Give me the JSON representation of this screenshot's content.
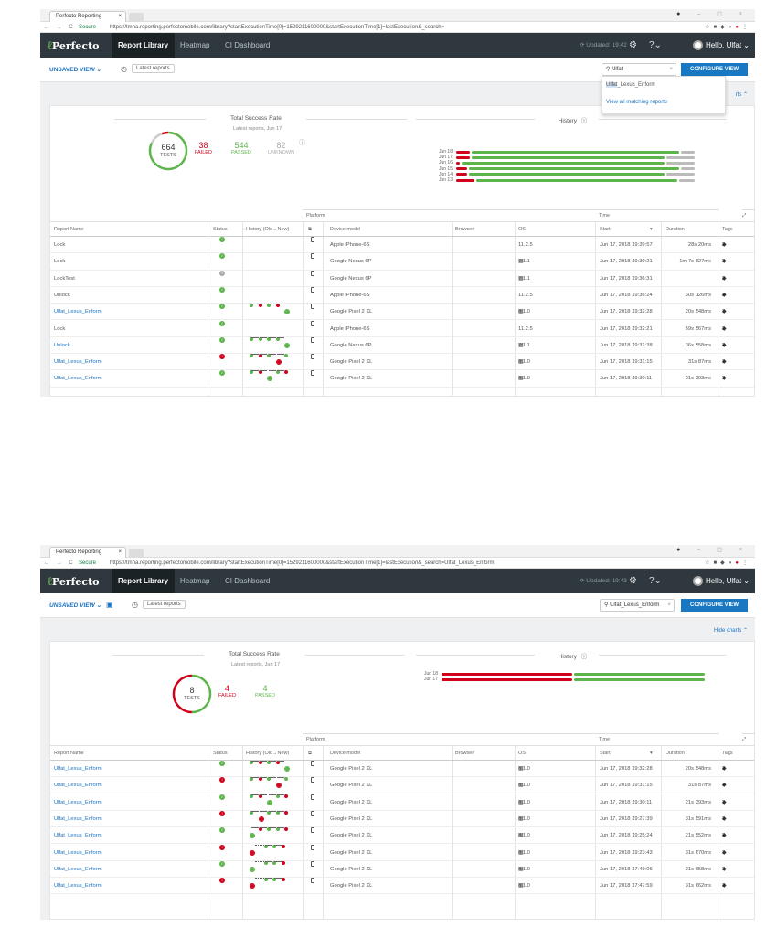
{
  "browser": {
    "tab_title": "Perfecto Reporting",
    "tab_close": "×",
    "nav": "← → C",
    "secure": "Secure",
    "window_controls": "– ◻ ×"
  },
  "app": {
    "logo": "Perfecto",
    "nav": [
      {
        "label": "Report Library"
      },
      {
        "label": "Heatmap"
      },
      {
        "label": "CI Dashboard"
      }
    ],
    "hello": "Hello, Ulfat"
  },
  "toolbar": {
    "unsaved_view": "UNSAVED VIEW",
    "latest": "Latest reports",
    "configure": "CONFIGURE VIEW"
  },
  "colors": {
    "accent": "#1a78c2",
    "header": "#2e383e",
    "passed": "#5db44b",
    "failed": "#d0021b",
    "unknown": "#aaaaaa"
  },
  "screens": [
    {
      "url": "https://tmna.reporting.perfectomobile.com/library?startExecutionTime[0]=1529211600000&startExecutionTime[1]=lastExecution&_search=",
      "updated": "Updated: 19:42",
      "search_value": "Ulfat",
      "dropdown": {
        "match_prefix": "Ulfat",
        "match_rest": "_Lexus_Enform",
        "view_all": "View all matching reports"
      },
      "hide_charts": "rts ⌃",
      "summary": {
        "title": "Total Success Rate",
        "subtitle": "Latest reports, Jun 17",
        "total": 664,
        "total_label": "TESTS",
        "failed": 38,
        "failed_label": "FAILED",
        "passed": 544,
        "passed_label": "PASSED",
        "unknown": 82,
        "unknown_label": "UNKNOWN"
      },
      "history": {
        "title": "History",
        "rows": [
          {
            "date": "Jun 18",
            "failed": 0.06,
            "passed": 0.82,
            "unknown": 0.06
          },
          {
            "date": "Jun 17",
            "failed": 0.06,
            "passed": 0.76,
            "unknown": 0.12
          },
          {
            "date": "Jun 16",
            "failed": 0.02,
            "passed": 0.8,
            "unknown": 0.12
          },
          {
            "date": "Jun 15",
            "failed": 0.05,
            "passed": 0.83,
            "unknown": 0.06
          },
          {
            "date": "Jun 14",
            "failed": 0.05,
            "passed": 0.77,
            "unknown": 0.12
          },
          {
            "date": "Jun 13",
            "failed": 0.08,
            "passed": 0.79,
            "unknown": 0.07
          }
        ]
      },
      "columns": {
        "platform": "Platform",
        "time": "Time",
        "name": "Report Name",
        "status": "Status",
        "history": "History (Old→New)",
        "device": "Device model",
        "browser": "Browser",
        "os": "OS",
        "start": "Start",
        "duration": "Duration",
        "tags": "Tags"
      },
      "rows": [
        {
          "name": "Lock",
          "link": false,
          "status": "passed",
          "hist": "",
          "device": "Apple iPhone-6S",
          "os": " 11.2.5",
          "os_icon": "apple",
          "start": "Jun 17, 2018 19:39:57",
          "duration": "28s 20ms",
          "tags": "2"
        },
        {
          "name": "Lock",
          "link": false,
          "status": "passed",
          "hist": "",
          "device": "Google Nexus 6P",
          "os": " 7.1.1",
          "os_icon": "android",
          "start": "Jun 17, 2018 19:39:21",
          "duration": "1m 7s 627ms",
          "tags": "2"
        },
        {
          "name": "LockTest",
          "link": false,
          "status": "unknown",
          "hist": "",
          "device": "Google Nexus 6P",
          "os": " 7.1.1",
          "os_icon": "android",
          "start": "Jun 17, 2018 19:36:31",
          "duration": "",
          "tags": "2"
        },
        {
          "name": "Unlock",
          "link": false,
          "status": "passed",
          "hist": "",
          "device": "Apple iPhone-6S",
          "os": " 11.2.5",
          "os_icon": "apple",
          "start": "Jun 17, 2018 19:36:24",
          "duration": "30s 126ms",
          "tags": "2"
        },
        {
          "name": "Ulfat_Lexus_Enform",
          "link": true,
          "status": "passed",
          "hist": "grgrG",
          "device": "Google Pixel 2 XL",
          "os": " 8.1.0",
          "os_icon": "android",
          "start": "Jun 17, 2018 19:32:28",
          "duration": "20s 548ms",
          "tags": "3"
        },
        {
          "name": "Lock",
          "link": false,
          "status": "passed",
          "hist": "",
          "device": "Apple iPhone-6S",
          "os": " 11.2.5",
          "os_icon": "apple",
          "start": "Jun 17, 2018 19:32:21",
          "duration": "59s 567ms",
          "tags": "2"
        },
        {
          "name": "Unlock",
          "link": true,
          "status": "passed",
          "hist": "ggggG",
          "device": "Google Nexus 6P",
          "os": " 7.1.1",
          "os_icon": "android",
          "start": "Jun 17, 2018 19:31:38",
          "duration": "36s 558ms",
          "tags": "2"
        },
        {
          "name": "Ulfat_Lexus_Enform",
          "link": true,
          "status": "failed",
          "hist": "grgRg",
          "device": "Google Pixel 2 XL",
          "os": " 8.1.0",
          "os_icon": "android",
          "start": "Jun 17, 2018 19:31:15",
          "duration": "31s 87ms",
          "tags": "3"
        },
        {
          "name": "Ulfat_Lexus_Enform",
          "link": true,
          "status": "passed",
          "hist": "grGgr",
          "device": "Google Pixel 2 XL",
          "os": " 8.1.0",
          "os_icon": "android",
          "start": "Jun 17, 2018 19:30:11",
          "duration": "21s 393ms",
          "tags": "3"
        }
      ]
    },
    {
      "url": "https://tmna.reporting.perfectomobile.com/library?startExecutionTime[0]=1529211600000&startExecutionTime[1]=lastExecution&_search=Ulfat_Lexus_Enform",
      "updated": "Updated: 19:43",
      "search_value": "Ulfat_Lexus_Enform",
      "hide_charts": "Hide charts ⌃",
      "summary": {
        "title": "Total Success Rate",
        "subtitle": "Latest reports, Jun 17",
        "total": 8,
        "total_label": "TESTS",
        "failed": 4,
        "failed_label": "FAILED",
        "passed": 4,
        "passed_label": "PASSED"
      },
      "history": {
        "title": "History",
        "rows": [
          {
            "date": "Jun 18",
            "failed": 0.5,
            "passed": 0.5,
            "unknown": 0
          },
          {
            "date": "Jun 17",
            "failed": 0.5,
            "passed": 0.5,
            "unknown": 0
          }
        ]
      },
      "columns": {
        "platform": "Platform",
        "time": "Time",
        "name": "Report Name",
        "status": "Status",
        "history": "History (Old→New)",
        "device": "Device model",
        "browser": "Browser",
        "os": "OS",
        "start": "Start",
        "duration": "Duration",
        "tags": "Tags"
      },
      "rows": [
        {
          "name": "Ulfat_Lexus_Enform",
          "link": true,
          "status": "passed",
          "hist": "grgrG",
          "device": "Google Pixel 2 XL",
          "os": " 8.1.0",
          "os_icon": "android",
          "start": "Jun 17, 2018 19:32:28",
          "duration": "20s 548ms",
          "tags": "3"
        },
        {
          "name": "Ulfat_Lexus_Enform",
          "link": true,
          "status": "failed",
          "hist": "grgRg",
          "device": "Google Pixel 2 XL",
          "os": " 8.1.0",
          "os_icon": "android",
          "start": "Jun 17, 2018 19:31:15",
          "duration": "31s 87ms",
          "tags": "3"
        },
        {
          "name": "Ulfat_Lexus_Enform",
          "link": true,
          "status": "passed",
          "hist": "grGgr",
          "device": "Google Pixel 2 XL",
          "os": " 8.1.0",
          "os_icon": "android",
          "start": "Jun 17, 2018 19:30:11",
          "duration": "21s 393ms",
          "tags": "3"
        },
        {
          "name": "Ulfat_Lexus_Enform",
          "link": true,
          "status": "failed",
          "hist": "gRggr",
          "device": "Google Pixel 2 XL",
          "os": " 8.1.0",
          "os_icon": "android",
          "start": "Jun 17, 2018 19:27:39",
          "duration": "31s 591ms",
          "tags": "3"
        },
        {
          "name": "Ulfat_Lexus_Enform",
          "link": true,
          "status": "passed",
          "hist": "Grggr",
          "device": "Google Pixel 2 XL",
          "os": " 8.1.0",
          "os_icon": "android",
          "start": "Jun 17, 2018 19:25:24",
          "duration": "21s 552ms",
          "tags": "3"
        },
        {
          "name": "Ulfat_Lexus_Enform",
          "link": true,
          "status": "failed",
          "hist": "R-ggr",
          "device": "Google Pixel 2 XL",
          "os": " 8.1.0",
          "os_icon": "android",
          "start": "Jun 17, 2018 19:23:43",
          "duration": "31s 670ms",
          "tags": "3"
        },
        {
          "name": "Ulfat_Lexus_Enform",
          "link": true,
          "status": "passed",
          "hist": "G-ggr",
          "device": "Google Pixel 2 XL",
          "os": " 8.1.0",
          "os_icon": "android",
          "start": "Jun 17, 2018 17:49:06",
          "duration": "21s 658ms",
          "tags": "3"
        },
        {
          "name": "Ulfat_Lexus_Enform",
          "link": true,
          "status": "failed",
          "hist": "R-ggr",
          "device": "Google Pixel 2 XL",
          "os": " 8.1.0",
          "os_icon": "android",
          "start": "Jun 17, 2018 17:47:59",
          "duration": "31s 662ms",
          "tags": "3"
        }
      ]
    }
  ]
}
